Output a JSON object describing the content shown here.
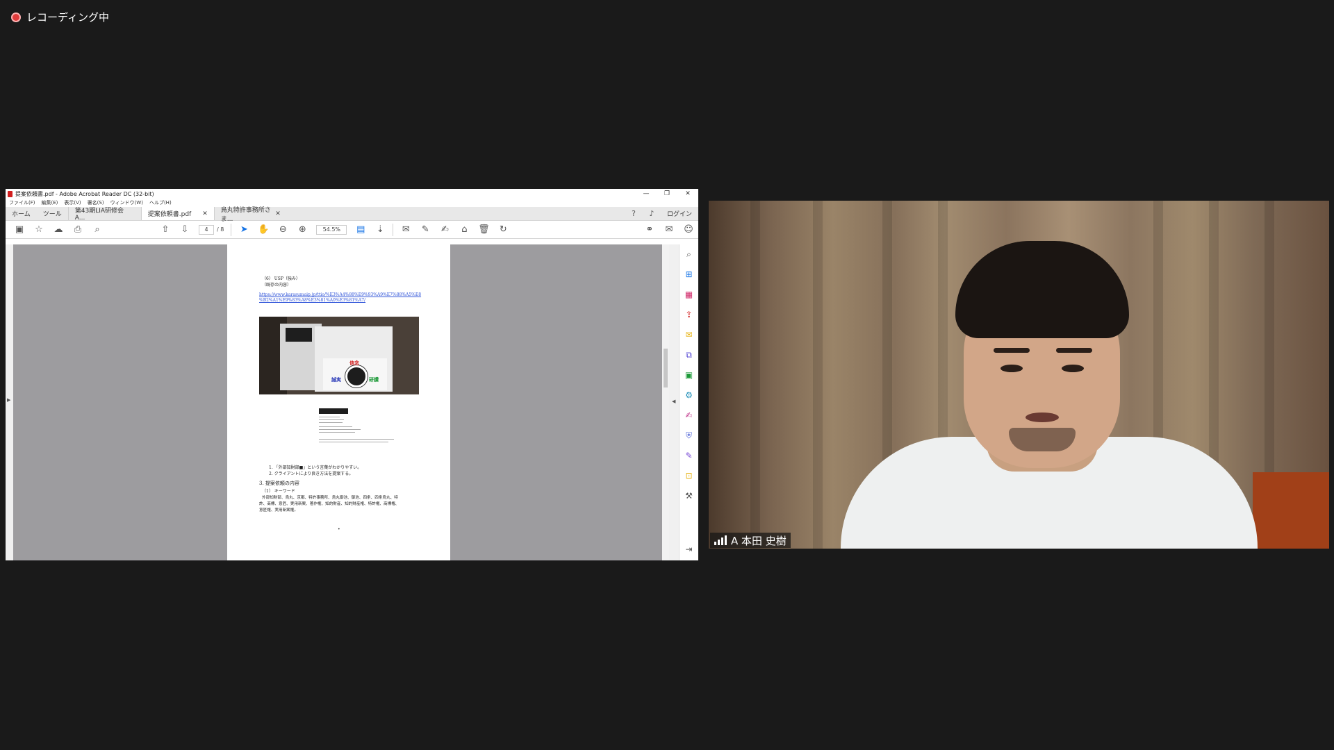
{
  "recording": {
    "label": "レコーディング中"
  },
  "acrobat": {
    "title": "提案依頼書.pdf - Adobe Acrobat Reader DC (32-bit)",
    "menu": [
      "ファイル(F)",
      "編集(E)",
      "表示(V)",
      "署名(S)",
      "ウィンドウ(W)",
      "ヘルプ(H)"
    ],
    "tabs": {
      "home": "ホーム",
      "tools": "ツール"
    },
    "doc_tabs": [
      "第43期LIA研修会 A...",
      "提案依頼書.pdf",
      "烏丸特許事務所さま..."
    ],
    "login": "ログイン",
    "page_current": "4",
    "page_total": "/ 8",
    "zoom": "54.5%",
    "icons": {
      "save": "save-icon",
      "bookmark": "star-icon",
      "upload": "upload-icon",
      "print": "print-icon",
      "search": "search-icon",
      "prev": "arrow-up-icon",
      "next": "arrow-down-icon",
      "select": "cursor-icon",
      "hand": "hand-icon",
      "zoom_out": "zoom-out-icon",
      "zoom_in": "zoom-in-icon"
    }
  },
  "pdf_page": {
    "heading": "（6） USP（強み）",
    "sub": "（既存の内容）",
    "link1": "https://www.karasumaip.jp/ttio/%E3%A4%88%E9%93%A9%E7%88%A5%E8",
    "link2": "%B2%A1%E9%83%A8%E3%81%A0%E3%81%A7/",
    "photo_labels": {
      "left": "誠実",
      "top": "信念",
      "right": "研鑽"
    },
    "bullet1": "1. 「外部知財部■」という言葉がわかりやすい。",
    "bullet2": "2. クライアントにより良き方法を提案する。",
    "section": "3.    提案依頼の内容",
    "sub_section": "（1）  キーワード",
    "keywords1": "外部知財部、烏丸、京都、特許事務所、烏丸御池、御池、四条、四条烏丸、特",
    "keywords2": "許、商標、意匠、実用新案、著作権、知的財産、知的財産権、特許権、商標権、",
    "keywords3": "意匠権、実用新案権。",
    "page_mark": "•"
  },
  "video": {
    "participant": "A 本田 史樹"
  }
}
